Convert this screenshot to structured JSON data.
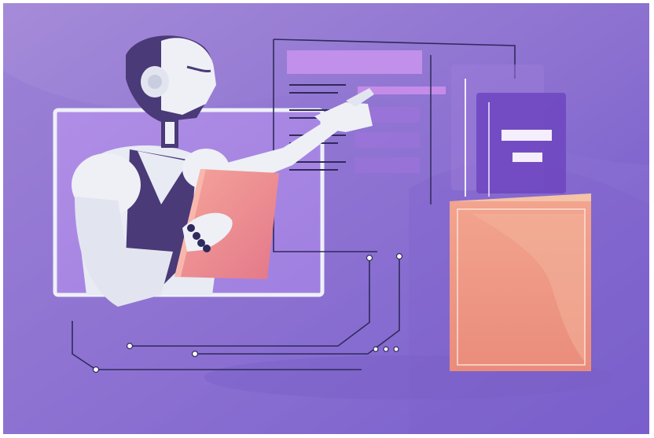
{
  "scene": {
    "subject": "robot-interacting-with-floating-documents",
    "colors": {
      "bg_start": "#9a7fd4",
      "bg_end": "#6a4fc4",
      "robot_light": "#eef0f6",
      "robot_shade": "#c9cde0",
      "robot_dark": "#4a3a78",
      "tablet": "#f08a8a",
      "tablet_edge": "#f2b3a8",
      "box_front": "#ef9a84",
      "box_top": "#f4c0a8",
      "circuit": "#2f2a5c",
      "panel_bar": "#b98ae6"
    },
    "icons": [
      "robot",
      "tablet",
      "document-panel",
      "book-box",
      "circuit-lines"
    ]
  }
}
